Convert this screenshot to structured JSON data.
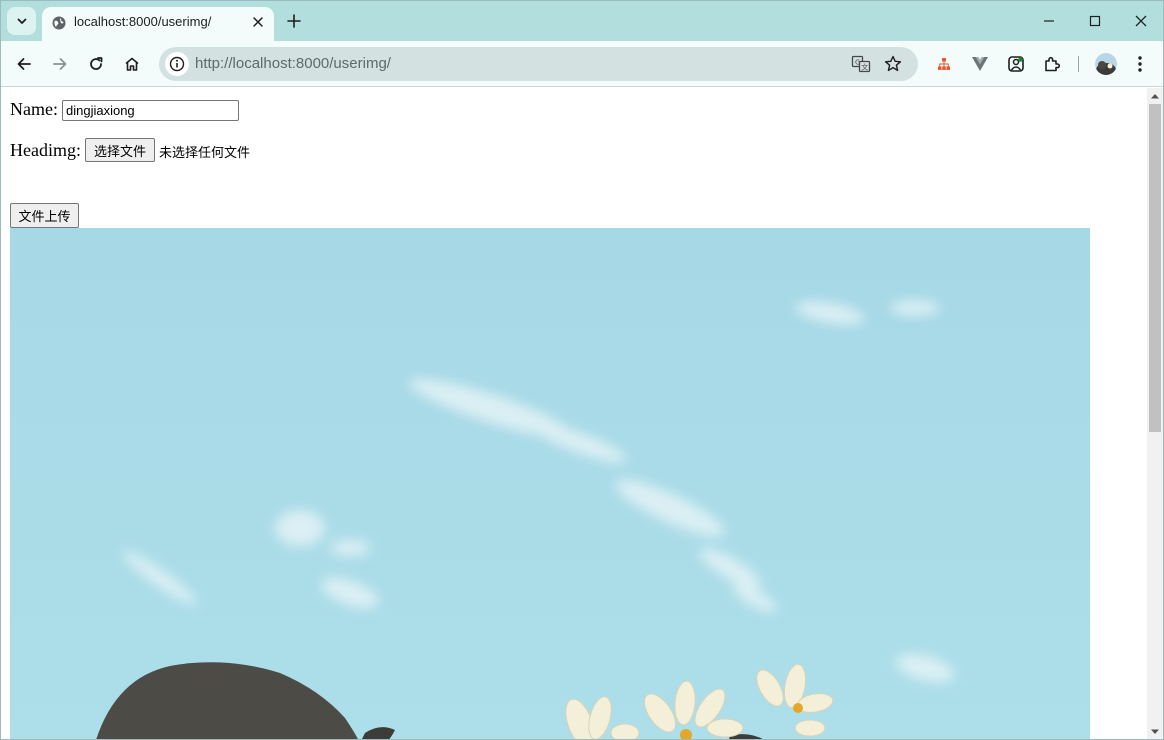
{
  "browser": {
    "tab": {
      "title": "localhost:8000/userimg/"
    },
    "address_bar": {
      "url_prefix": "http://",
      "url_main": "localhost:8000/userimg/"
    }
  },
  "form": {
    "name_label": "Name:",
    "name_value": "dingjiaxiong",
    "headimg_label": "Headimg:",
    "choose_file_label": "选择文件",
    "no_file_text": "未选择任何文件",
    "upload_label": "文件上传"
  },
  "colors": {
    "tabstrip": "#b2dfdd",
    "toolbar": "#f3fbfb",
    "omnibox": "#d3e2e1",
    "sky": "#a8d9e6"
  },
  "icons": [
    "tab-search-icon",
    "globe-icon",
    "close-icon",
    "plus-icon",
    "minimize-icon",
    "maximize-icon",
    "back-icon",
    "forward-icon",
    "reload-icon",
    "home-icon",
    "info-icon",
    "translate-icon",
    "star-icon",
    "extension-icon",
    "puzzle-icon",
    "menu-icon"
  ]
}
